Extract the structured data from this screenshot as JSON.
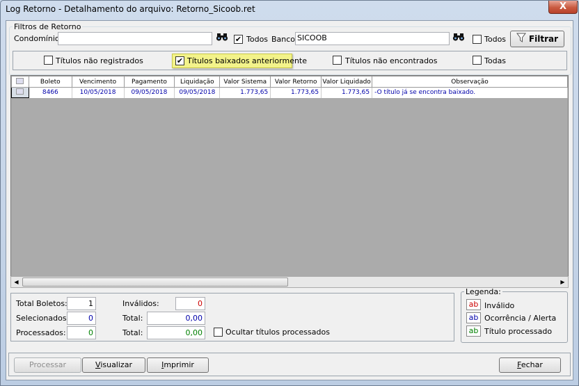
{
  "window": {
    "title": "Log Retorno - Detalhamento do arquivo: Retorno_Sicoob.ret",
    "close_glyph": "X"
  },
  "filters": {
    "group_title": "Filtros de Retorno",
    "condominio_label": "Condomínio:",
    "condominio_value": "",
    "todos_condominio_label": "Todos",
    "todos_condominio_checked": true,
    "banco_label": "Banco:",
    "banco_value": "SICOOB",
    "todos_banco_label": "Todos",
    "todos_banco_checked": false,
    "filtrar_label": "Filtrar",
    "options": [
      {
        "label": "Títulos não registrados",
        "checked": false
      },
      {
        "label": "Títulos baixados anteriormente",
        "checked": true
      },
      {
        "label": "Títulos não encontrados",
        "checked": false
      },
      {
        "label": "Todas",
        "checked": false
      }
    ]
  },
  "grid": {
    "columns": [
      "Boleto",
      "Vencimento",
      "Pagamento",
      "Liquidação",
      "Valor Sistema",
      "Valor Retorno",
      "Valor Liquidado",
      "Observação"
    ],
    "rows": [
      {
        "boleto": "8466",
        "vencimento": "10/05/2018",
        "pagamento": "09/05/2018",
        "liquidacao": "09/05/2018",
        "valor_sistema": "1.773,65",
        "valor_retorno": "1.773,65",
        "valor_liquidado": "1.773,65",
        "observacao": "-O título já se encontra baixado."
      }
    ]
  },
  "summary": {
    "total_boletos_label": "Total Boletos:",
    "total_boletos_value": "1",
    "selecionados_label": "Selecionados:",
    "selecionados_value": "0",
    "processados_label": "Processados:",
    "processados_value": "0",
    "invalidos_label": "Inválidos:",
    "invalidos_value": "0",
    "total_label": "Total:",
    "total_selecionados_value": "0,00",
    "total_processados_value": "0,00",
    "ocultar_label": "Ocultar títulos processados",
    "ocultar_checked": false
  },
  "legend": {
    "title": "Legenda:",
    "items": [
      {
        "swatch": "ab",
        "label": "Inválido",
        "color": "#cc0000"
      },
      {
        "swatch": "ab",
        "label": "Ocorrência / Alerta",
        "color": "#0000aa"
      },
      {
        "swatch": "ab",
        "label": "Título processado",
        "color": "#008000"
      }
    ]
  },
  "buttons": {
    "processar": "Processar",
    "visualizar": "Visualizar",
    "imprimir": "Imprimir",
    "fechar": "Fechar"
  },
  "colors": {
    "highlight": "#f3f38a",
    "invalid_value": "#cc0000",
    "ok_value": "#008000",
    "blue_value": "#0000aa"
  }
}
